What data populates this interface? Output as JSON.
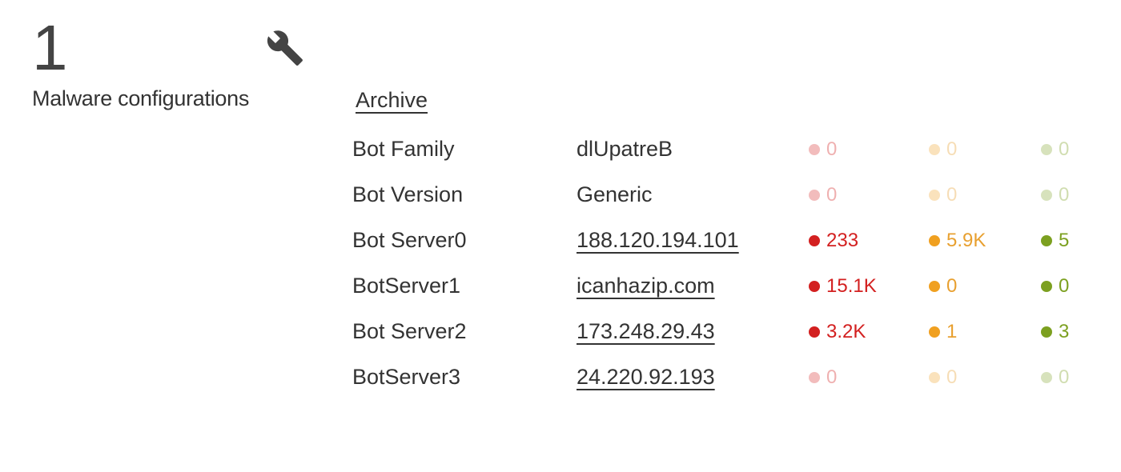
{
  "summary": {
    "count": "1",
    "label": "Malware configurations"
  },
  "archive_label": "Archive",
  "rows": [
    {
      "label": "Bot Family",
      "value": "dlUpatreB",
      "linked": false,
      "red": "0",
      "orange": "0",
      "green": "0",
      "active": false
    },
    {
      "label": "Bot Version",
      "value": "Generic",
      "linked": false,
      "red": "0",
      "orange": "0",
      "green": "0",
      "active": false
    },
    {
      "label": "Bot Server0",
      "value": "188.120.194.101",
      "linked": true,
      "red": "233",
      "orange": "5.9K",
      "green": "5",
      "active": true
    },
    {
      "label": "BotServer1",
      "value": "icanhazip.com",
      "linked": true,
      "red": "15.1K",
      "orange": "0",
      "green": "0",
      "active": true
    },
    {
      "label": "Bot Server2",
      "value": "173.248.29.43",
      "linked": true,
      "red": "3.2K",
      "orange": "1",
      "green": "3",
      "active": true
    },
    {
      "label": "BotServer3",
      "value": "24.220.92.193",
      "linked": true,
      "red": "0",
      "orange": "0",
      "green": "0",
      "active": false
    }
  ]
}
